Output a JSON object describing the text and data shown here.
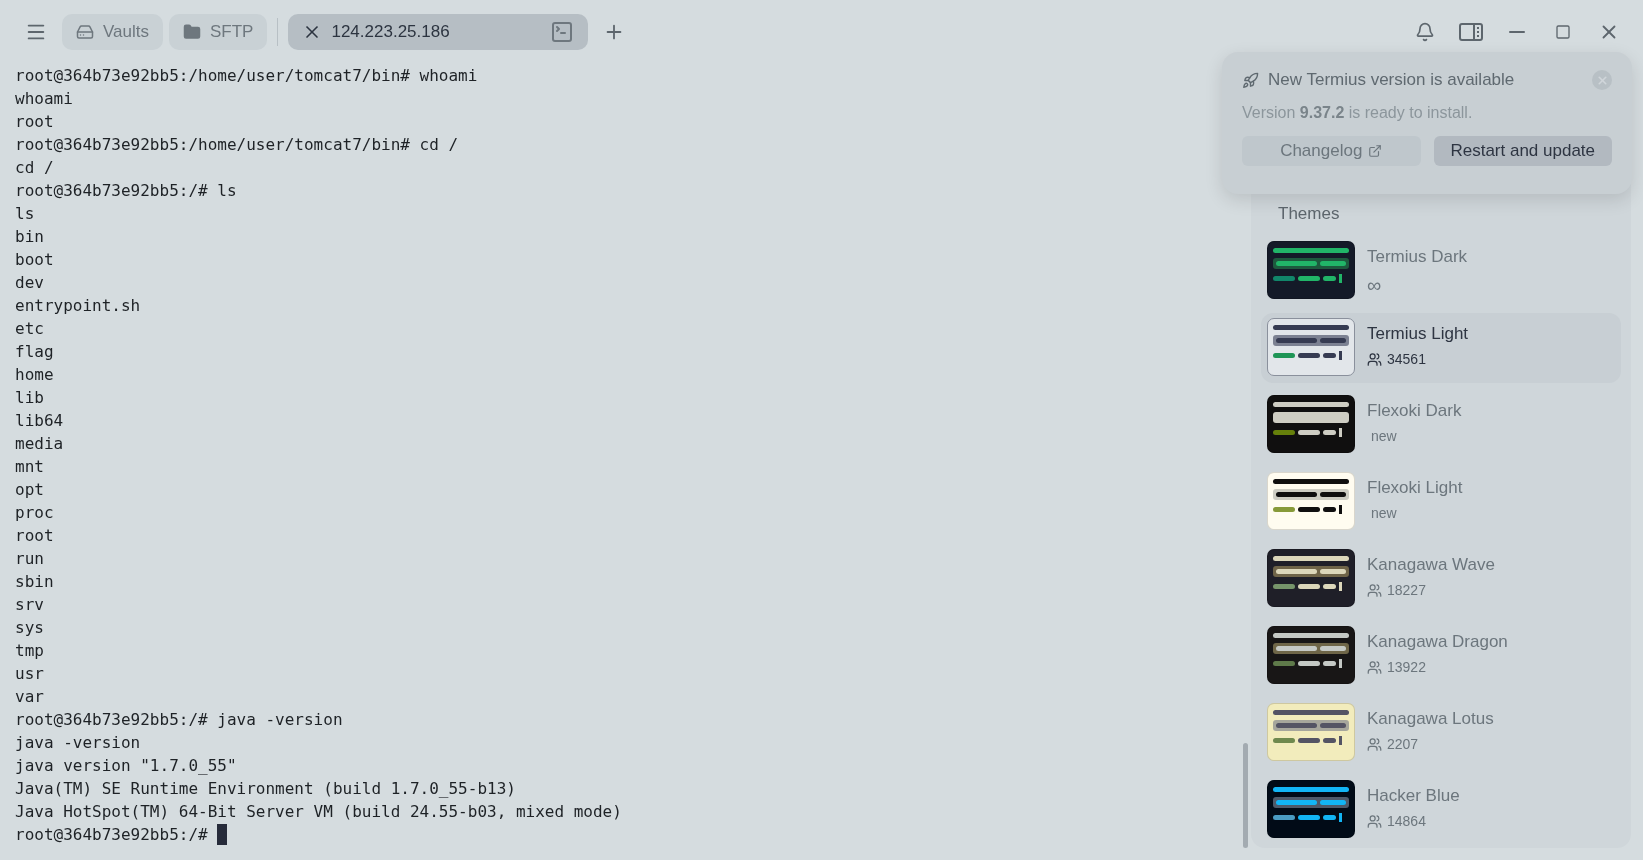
{
  "tabs": [
    {
      "kind": "vaults",
      "label": "Vaults",
      "selected": false
    },
    {
      "kind": "sftp",
      "label": "SFTP",
      "selected": false
    },
    {
      "kind": "host",
      "label": "124.223.25.186",
      "selected": true
    }
  ],
  "terminal": {
    "lines": [
      "root@364b73e92bb5:/home/user/tomcat7/bin# whoami",
      "whoami",
      "root",
      "root@364b73e92bb5:/home/user/tomcat7/bin# cd /",
      "cd /",
      "root@364b73e92bb5:/# ls",
      "ls",
      "bin",
      "boot",
      "dev",
      "entrypoint.sh",
      "etc",
      "flag",
      "home",
      "lib",
      "lib64",
      "media",
      "mnt",
      "opt",
      "proc",
      "root",
      "run",
      "sbin",
      "srv",
      "sys",
      "tmp",
      "usr",
      "var",
      "root@364b73e92bb5:/# java -version",
      "java -version",
      "java version \"1.7.0_55\"",
      "Java(TM) SE Runtime Environment (build 1.7.0_55-b13)",
      "Java HotSpot(TM) 64-Bit Server VM (build 24.55-b03, mixed mode)"
    ],
    "prompt": "root@364b73e92bb5:/# "
  },
  "notification": {
    "title": "New Termius version is available",
    "message": "Version **9.37.2** is ready to install.",
    "buttons": [
      {
        "kind": "link",
        "label": "Changelog"
      },
      {
        "kind": "primary",
        "label": "Restart and update"
      }
    ]
  },
  "themes": {
    "title": "Themes",
    "items": [
      {
        "name": "Termius Dark",
        "kind": "infinite",
        "meta": "∞",
        "selected": false,
        "palette": [
          {
            "color": "#141a28"
          },
          {
            "color": "#21b568"
          },
          {
            "color": "#1d5a3e"
          },
          {
            "color": "#11866a"
          }
        ]
      },
      {
        "name": "Termius Light",
        "kind": "users",
        "meta": "34561",
        "selected": true,
        "palette": [
          {
            "color": "#e2e6ea"
          },
          {
            "color": "#363b52"
          },
          {
            "color": "#7c8192"
          },
          {
            "color": "#1f9556"
          }
        ]
      },
      {
        "name": "Flexoki Dark",
        "kind": "new",
        "meta": "new",
        "selected": false,
        "palette": [
          {
            "color": "#100f0f"
          },
          {
            "color": "#cecdc3"
          },
          {
            "color": "#cecdc3"
          },
          {
            "color": "#66800b"
          }
        ]
      },
      {
        "name": "Flexoki Light",
        "kind": "new",
        "meta": "new",
        "selected": false,
        "palette": [
          {
            "color": "#fffcf0"
          },
          {
            "color": "#100f0f"
          },
          {
            "color": "#cecdc3"
          },
          {
            "color": "#879a39"
          }
        ]
      },
      {
        "name": "Kanagawa Wave",
        "kind": "users",
        "meta": "18227",
        "selected": false,
        "palette": [
          {
            "color": "#1f1f28"
          },
          {
            "color": "#dcd7ba"
          },
          {
            "color": "#6f6448"
          },
          {
            "color": "#76946a"
          }
        ]
      },
      {
        "name": "Kanagawa Dragon",
        "kind": "users",
        "meta": "13922",
        "selected": false,
        "palette": [
          {
            "color": "#181616"
          },
          {
            "color": "#c5c9c5"
          },
          {
            "color": "#6f6648"
          },
          {
            "color": "#5f7a4a"
          }
        ]
      },
      {
        "name": "Kanagawa Lotus",
        "kind": "users",
        "meta": "2207",
        "selected": false,
        "palette": [
          {
            "color": "#f2ecbc"
          },
          {
            "color": "#545464"
          },
          {
            "color": "#a6a69c"
          },
          {
            "color": "#6f894e"
          }
        ]
      },
      {
        "name": "Hacker Blue",
        "kind": "users",
        "meta": "14864",
        "selected": false,
        "palette": [
          {
            "color": "#010b17"
          },
          {
            "color": "#12b5f5"
          },
          {
            "color": "#4e5a6a"
          },
          {
            "color": "#4a9bc2"
          }
        ]
      }
    ]
  }
}
